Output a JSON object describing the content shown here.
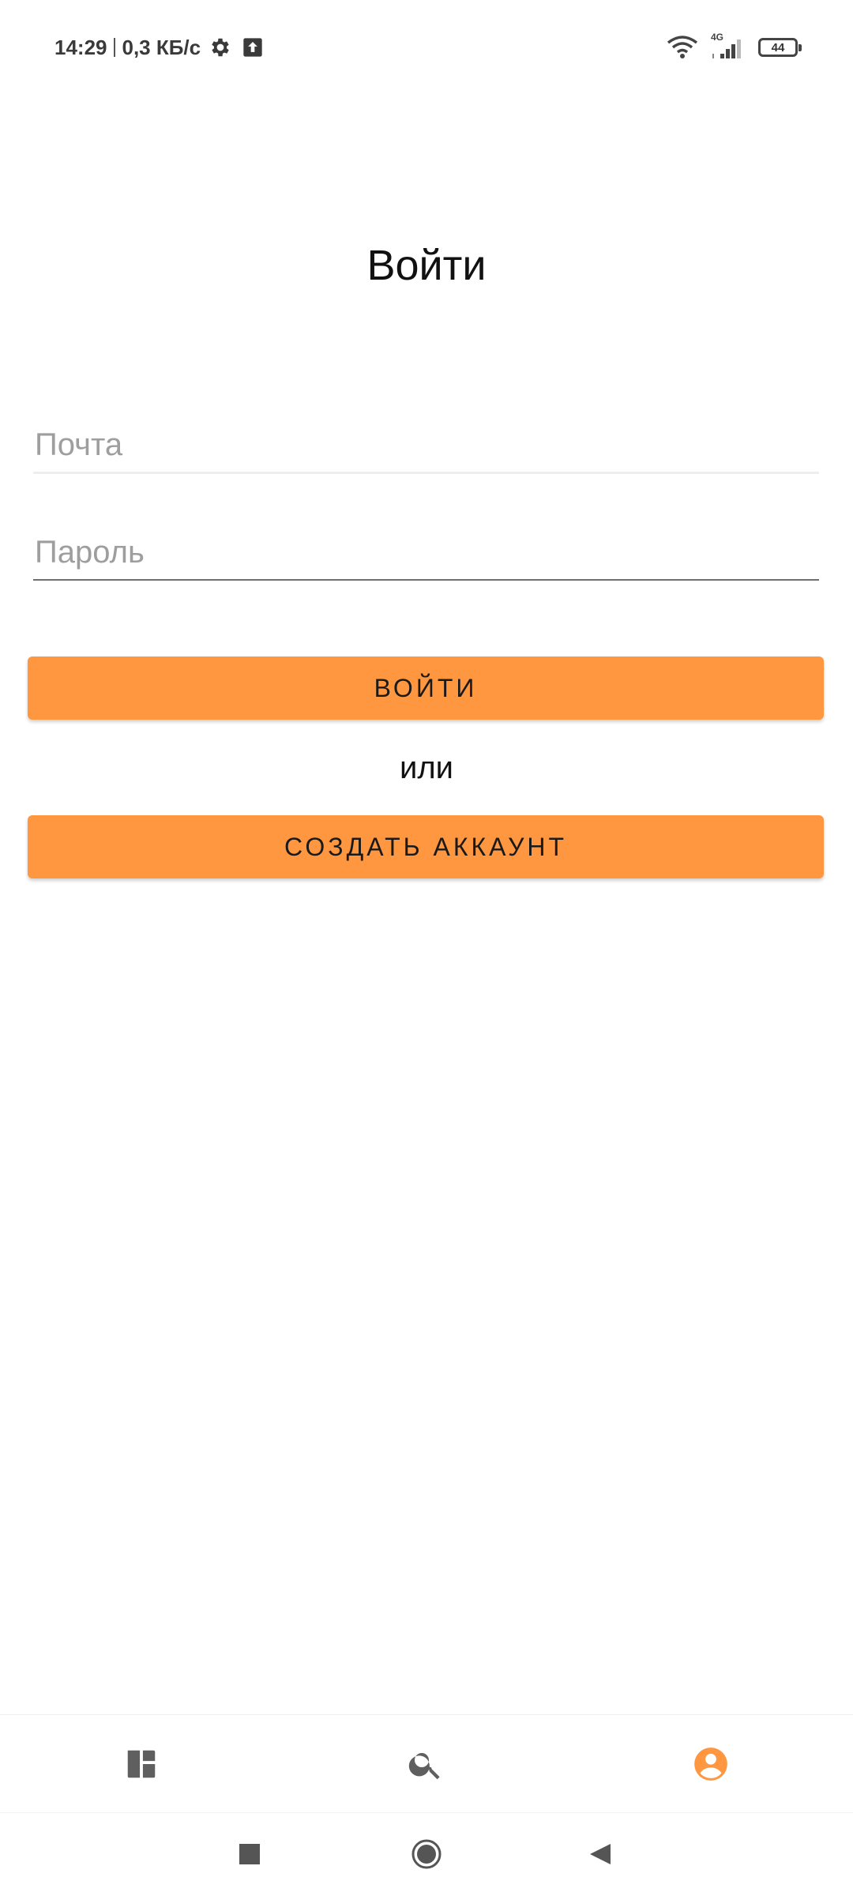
{
  "status_bar": {
    "time": "14:29",
    "net_speed": "0,3 КБ/с",
    "network_type": "4G",
    "battery": "44",
    "icons": [
      "gear-icon",
      "upload-icon",
      "wifi-icon",
      "signal-icon",
      "battery-icon"
    ]
  },
  "login": {
    "title": "Войти",
    "email_placeholder": "Почта",
    "email_value": "",
    "password_placeholder": "Пароль",
    "password_value": "",
    "login_button": "ВОЙТИ",
    "or_text": "или",
    "create_account_button": "СОЗДАТЬ АККАУНТ"
  },
  "bottom_nav": {
    "items": [
      {
        "icon": "dashboard-icon",
        "active": false
      },
      {
        "icon": "search-icon",
        "active": false
      },
      {
        "icon": "account-icon",
        "active": true
      }
    ]
  },
  "colors": {
    "accent": "#ff9640",
    "nav_inactive": "#5f5f5f",
    "placeholder": "#9e9e9e"
  }
}
